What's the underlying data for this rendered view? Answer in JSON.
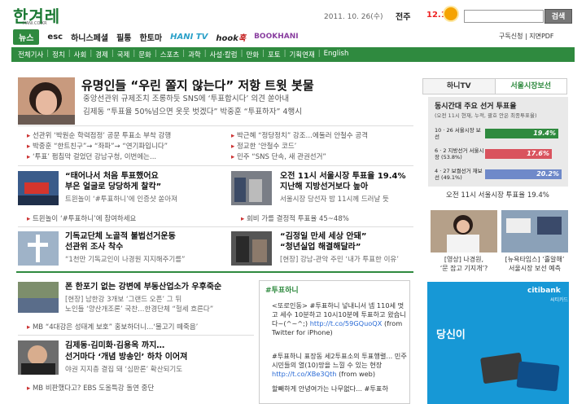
{
  "header": {
    "logo": "한겨레",
    "logo_sub": "HANI.CO.KR",
    "date": "2011. 10. 26(수)",
    "weather_city": "전주",
    "weather_temp": "12.1",
    "search_button": "검색"
  },
  "nav_main": {
    "items": [
      "뉴스",
      "esc",
      "하니스페셜",
      "필통",
      "한토마",
      "HANI TV",
      "hook",
      "BOOKHANI"
    ],
    "hook_suffix": "훅",
    "right": "구독신청 | 지면PDF"
  },
  "nav_sub": [
    "전체기사",
    "정치",
    "사회",
    "경제",
    "국제",
    "문화",
    "스포츠",
    "과학",
    "사설·칼럼",
    "만화",
    "포토",
    "기획연재",
    "English"
  ],
  "headline": {
    "title": "유명인들 “우린 쫄지 않는다” 저항 트윗 봇물",
    "sub1": "중앙선관위 규제조치 조롱하듯 SNS에 ‘투표합시다’ 의견 쏟아내",
    "sub2": "김제동 “투표율 50%넘으면 옷웃 벗겠다” 박중훈 “투표하자” 4행시"
  },
  "bullets_left": [
    "선관위 ‘박원순 학력점정’ 공문 투표소 부착 강행",
    "박중훈 “한트친구”→ “좌파”→ “연기파입니다”",
    "‘투표’ 펌침막 걸었던 강남구청, 이번에는..."
  ],
  "bullets_right": [
    "박근혜 “정당정치” 강조…에둘러 안철수 공격",
    "정교한 ‘안철수 코드’",
    "민주 “SNS 단속, 새 관권선거”"
  ],
  "story1": {
    "title1": "“태어나서 처음 투표했어요",
    "title2": "부은 얼굴로 당당하게 찰칵”",
    "sub": "트윈놀이 ‘#투표하니’에 인증샷 쏟아져",
    "bullet": "트윈놀이 ‘#투표하니’에 참여하세요"
  },
  "story2": {
    "title1": "오전 11시 서울시장 투표율 19.4%",
    "title2": "지난해 지방선거보다 높아",
    "sub": "서울시장 당선자 밤 11시께 드러날 듯",
    "bullet": "회비 가를 결정적 투표율 45~48%"
  },
  "story3": {
    "title1": "기독교단체 노골적 불법선거운동",
    "title2": "선관위 조사 착수",
    "sub": "“1천만 기독교인이 나경원 지지해주기를”"
  },
  "story4": {
    "title1": "“김정일 만세 세상 안돼”",
    "title2": "“청년실업 해결해달라”",
    "sub": "[현장] 강남-관악 주민 ‘내가 투표한 이유’"
  },
  "story5": {
    "title": "폰 한포기 없는 강변에 부동산업소가 우후죽순",
    "sub1": "[현장] 남한강 3개보 ‘그랜드 오픈’ 그 뒤",
    "sub2": "노인들 ‘양산개조론’ 국찬…한경단체 “헐세 흐른다”",
    "bullet": "MB “4대강은 성태계 보호” 홍보하더니…‘물고기 떼죽음’"
  },
  "story6": {
    "title1": "김제동·김미화·김용옥 까지…",
    "title2": "선거마다 ‘개념 방송인’ 하차 이어져",
    "sub": "야권 지지층 결집 돼 ‘심판론’ 확산되기도",
    "bullet": "MB 비판했다고? EBS 도올특강 돌연 중단"
  },
  "hashbox": {
    "title": "#투표하니",
    "tweets": [
      {
        "l1": "<또로인동> #투표하니 넣내니서 넴 110세 멋고 세수 10분하고 10시10분에 투표하고 왔습니다~(^~^;)",
        "link": "http://t.co/59GQuoQX",
        "src": "(from Twitter for iPhone)"
      },
      {
        "l1": "#투표하니 표장동 세2투표소의 투표행렬... 민주시민들의 열(10)망을 느낄 수 있는 현장",
        "link": "http://t.co/XBe3Qth",
        "src": "(from web)"
      },
      {
        "l1": "할빼하게 안녕여가는 나무없다... #투표하",
        "link": "",
        "src": ""
      }
    ]
  },
  "right_panel": {
    "tabs": [
      "하니TV",
      "서울시장보선"
    ],
    "vote_title": "동시간대 주요 선거 투표율",
    "vote_sub": "(오전 11시 현재, 누적, 괄호 안은 최종투표율)",
    "rows": [
      {
        "label": "10 · 26 서울시장 보선",
        "value": "19.4%",
        "pct": 19.4,
        "color": "#2f8a3f"
      },
      {
        "label": "6 · 2 지방선거 서울시장 (53.8%)",
        "value": "17.6%",
        "pct": 17.6,
        "color": "#d9535e"
      },
      {
        "label": "4 · 27 보궐선거 재보선 (49.1%)",
        "value": "20.2%",
        "pct": 20.2,
        "color": "#6f89c9"
      }
    ],
    "vote_caption": "오전 11시 서울시장 투표율 19.4%",
    "photos": [
      {
        "cap1": "[영상] 나경원,",
        "cap2": "‘문 잡고 기지개’?"
      },
      {
        "cap1": "[뉴욕타임스] ‘홀알해’",
        "cap2": "서울시장 보선 예측"
      }
    ]
  },
  "ad": {
    "brand": "citibank",
    "brand_sub": "씨티카드",
    "text": "당신이"
  },
  "colors": {
    "brand_green": "#2f8a3f",
    "accent_red": "#c33",
    "ad_blue": "#1798d6"
  }
}
